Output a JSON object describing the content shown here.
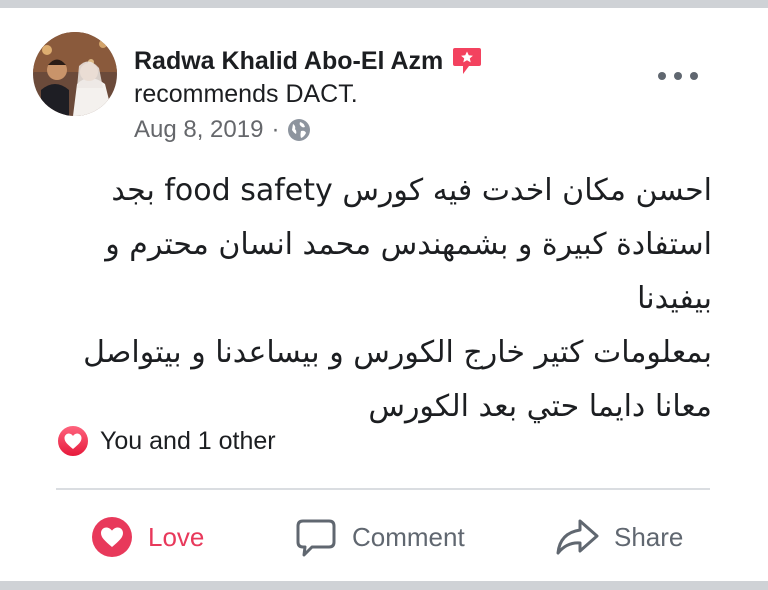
{
  "post": {
    "author_name": "Radwa Khalid Abo-El Azm",
    "recommend_prefix": "recommends ",
    "recommended_page": "DACT",
    "recommend_suffix": ".",
    "date": "Aug 8, 2019",
    "separator": "·",
    "privacy_icon": "globe-icon",
    "text_lines": [
      "احسن مكان اخدت فيه كورس food safety بجد",
      "استفادة كبيرة و بشمهندس محمد انسان محترم و بيفيدنا",
      "بمعلومات كتير خارج الكورس و بيساعدنا و بيتواصل",
      "معانا دايما حتي بعد الكورس"
    ]
  },
  "reactions": {
    "summary": "You and 1 other",
    "icon": "heart-icon"
  },
  "actions": {
    "love": "Love",
    "comment": "Comment",
    "share": "Share"
  },
  "colors": {
    "love_red": "#e8395b",
    "secondary_text": "#65676b",
    "recommend_badge": "#f3425f"
  }
}
